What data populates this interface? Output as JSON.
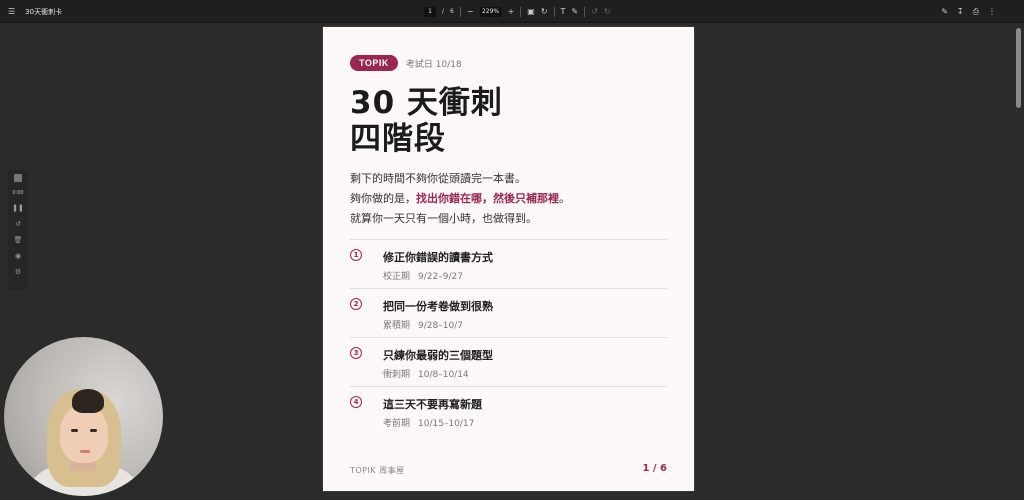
{
  "toolbar": {
    "menu_icon": "menu-icon",
    "title": "30天衝刺卡",
    "page_current": "1",
    "page_separator": "/",
    "page_total": "6",
    "zoom_out": "−",
    "zoom_value": "229%",
    "zoom_in": "+",
    "right_icons": [
      "annotate-icon",
      "download-icon",
      "print-icon",
      "more-icon"
    ]
  },
  "side_tools": {
    "timer": "0:00"
  },
  "document": {
    "badge": "TOPIK",
    "exam_date": "考試日 10/18",
    "title_lines": [
      "30 天衝刺",
      "四階段"
    ],
    "intro": {
      "line1": "剩下的時間不夠你從頭讀完一本書。",
      "line2_prefix": "夠你做的是，",
      "line2_hl1": "找出你錯在哪",
      "line2_hl_sep": "，",
      "line2_hl2": "然後只補那裡",
      "line2_suffix": "。",
      "line3": "就算你一天只有一個小時，也做得到。"
    },
    "phases": [
      {
        "number": "1",
        "title": "修正你錯誤的讀書方式",
        "stage": "校正期",
        "dates": "9/22–9/27"
      },
      {
        "number": "2",
        "title": "把同一份考卷做到很熟",
        "stage": "累積期",
        "dates": "9/28–10/7"
      },
      {
        "number": "3",
        "title": "只練你最弱的三個題型",
        "stage": "衝刺期",
        "dates": "10/8–10/14"
      },
      {
        "number": "4",
        "title": "這三天不要再寫新題",
        "stage": "考前期",
        "dates": "10/15–10/17"
      }
    ],
    "footer_left": "TOPIK 周事屋",
    "footer_right": "1 / 6"
  },
  "colors": {
    "accent": "#9b2650",
    "page_bg": "#fdf9f9",
    "app_bg": "#2b2b2b"
  }
}
